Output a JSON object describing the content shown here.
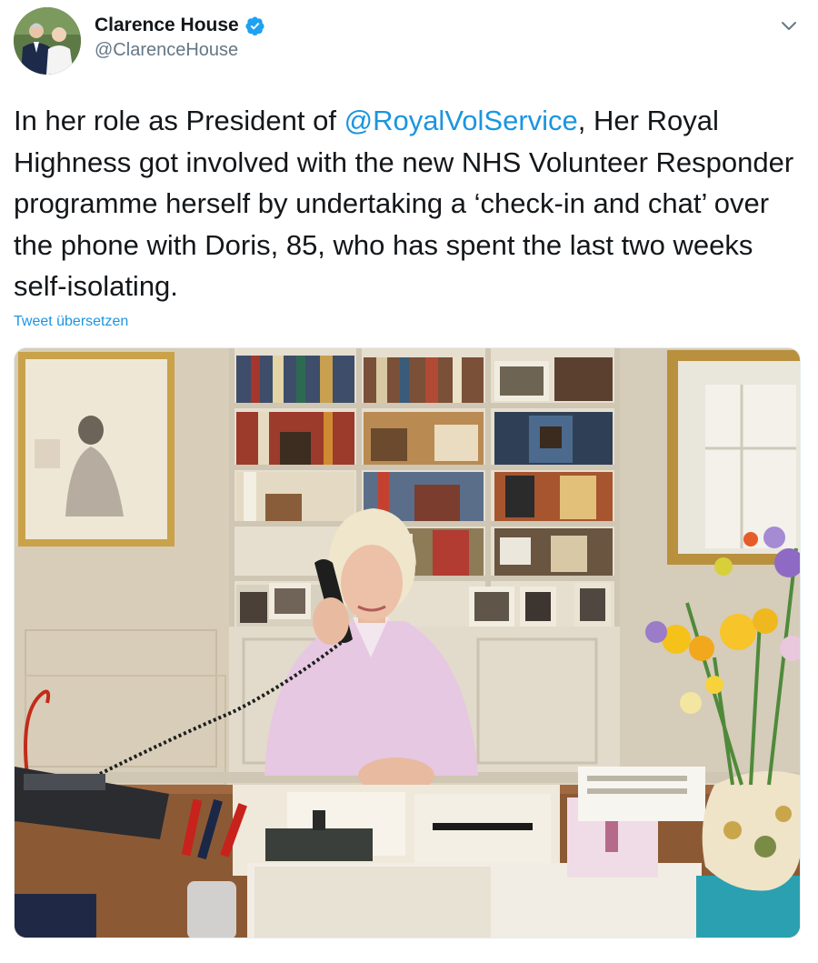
{
  "author": {
    "display_name": "Clarence House",
    "handle": "@ClarenceHouse",
    "verified": true,
    "verified_icon": "verified-badge-icon",
    "avatar_icon": "profile-photo"
  },
  "tweet": {
    "text_before": "In her role as President of ",
    "mention": "@RoyalVolService",
    "text_after": ", Her Royal Highness got involved with the new NHS Volunteer Responder programme herself by undertaking a ‘check-in and chat’ over the phone with Doris, 85, who has spent the last two weeks self-isolating.",
    "translate_link": "Tweet übersetzen"
  },
  "media": {
    "type": "photo"
  },
  "colors": {
    "link": "#1b95e0",
    "verified": "#1da1f2",
    "secondary_text": "#657786",
    "primary_text": "#14171a"
  }
}
